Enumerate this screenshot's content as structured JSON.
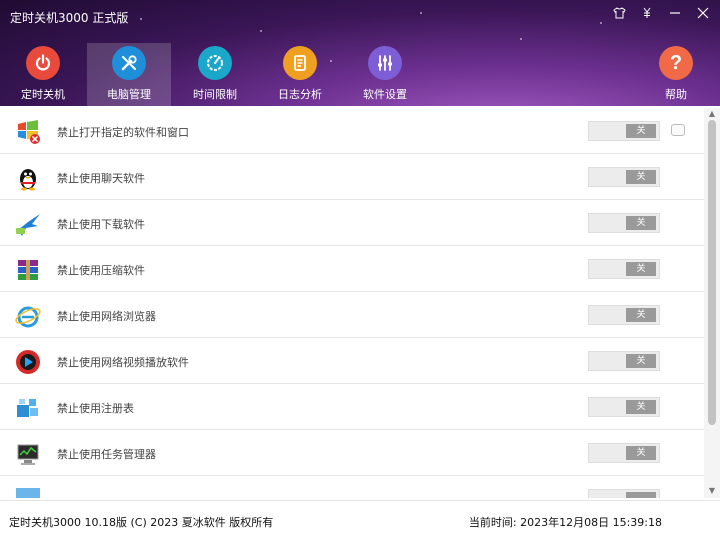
{
  "window": {
    "title": "定时关机3000 正式版"
  },
  "tabs": [
    {
      "label": "定时关机",
      "icon": "power-icon",
      "color": "#e84a3c"
    },
    {
      "label": "电脑管理",
      "icon": "tools-icon",
      "color": "#1e8fd8",
      "active": true
    },
    {
      "label": "时间限制",
      "icon": "timer-icon",
      "color": "#1aa7c9"
    },
    {
      "label": "日志分析",
      "icon": "log-icon",
      "color": "#f0a020"
    },
    {
      "label": "软件设置",
      "icon": "settings-icon",
      "color": "#7e5ed6"
    }
  ],
  "help": {
    "label": "帮助",
    "icon": "question-icon",
    "color": "#f06a48"
  },
  "rows": [
    {
      "label": "禁止打开指定的软件和窗口",
      "toggle": "关",
      "icon": "windows-block-icon"
    },
    {
      "label": "禁止使用聊天软件",
      "toggle": "关",
      "icon": "qq-penguin-icon"
    },
    {
      "label": "禁止使用下载软件",
      "toggle": "关",
      "icon": "thunder-download-icon"
    },
    {
      "label": "禁止使用压缩软件",
      "toggle": "关",
      "icon": "winrar-icon"
    },
    {
      "label": "禁止使用网络浏览器",
      "toggle": "关",
      "icon": "ie-browser-icon"
    },
    {
      "label": "禁止使用网络视频播放软件",
      "toggle": "关",
      "icon": "video-player-icon"
    },
    {
      "label": "禁止使用注册表",
      "toggle": "关",
      "icon": "registry-icon"
    },
    {
      "label": "禁止使用任务管理器",
      "toggle": "关",
      "icon": "task-manager-icon"
    }
  ],
  "footer": {
    "copyright": "定时关机3000 10.18版 (C) 2023  夏冰软件 版权所有",
    "time_label": "当前时间:",
    "time_value": "2023年12月08日 15:39:18"
  }
}
